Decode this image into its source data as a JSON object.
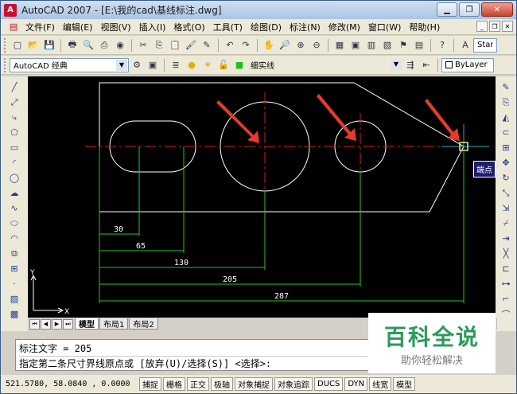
{
  "title": "AutoCAD 2007 - [E:\\我的cad\\基线标注.dwg]",
  "menu": [
    "文件(F)",
    "编辑(E)",
    "视图(V)",
    "插入(I)",
    "格式(O)",
    "工具(T)",
    "绘图(D)",
    "标注(N)",
    "修改(M)",
    "窗口(W)",
    "帮助(H)"
  ],
  "toolbar": {
    "workspace": "AutoCAD 经典",
    "layer": "细实线",
    "lineweight": "ByLayer",
    "textstyle": "Stand"
  },
  "drawing": {
    "dimensions": [
      "30",
      "65",
      "130",
      "205",
      "287"
    ],
    "tooltip": "端点",
    "ucs_x": "X",
    "ucs_y": "Y"
  },
  "tabs": [
    "模型",
    "布局1",
    "布局2"
  ],
  "command": {
    "line1": "标注文字 = 205",
    "line2": "指定第二条尺寸界线原点或 [放弃(U)/选择(S)] <选择>:"
  },
  "status": {
    "coords": "521.5780, 58.0840 , 0.0000",
    "buttons": [
      "捕捉",
      "栅格",
      "正交",
      "极轴",
      "对象捕捉",
      "对象追踪",
      "DUCS",
      "DYN",
      "线宽",
      "模型"
    ]
  },
  "watermark": {
    "big": "百科全说",
    "small": "助你轻松解决"
  }
}
